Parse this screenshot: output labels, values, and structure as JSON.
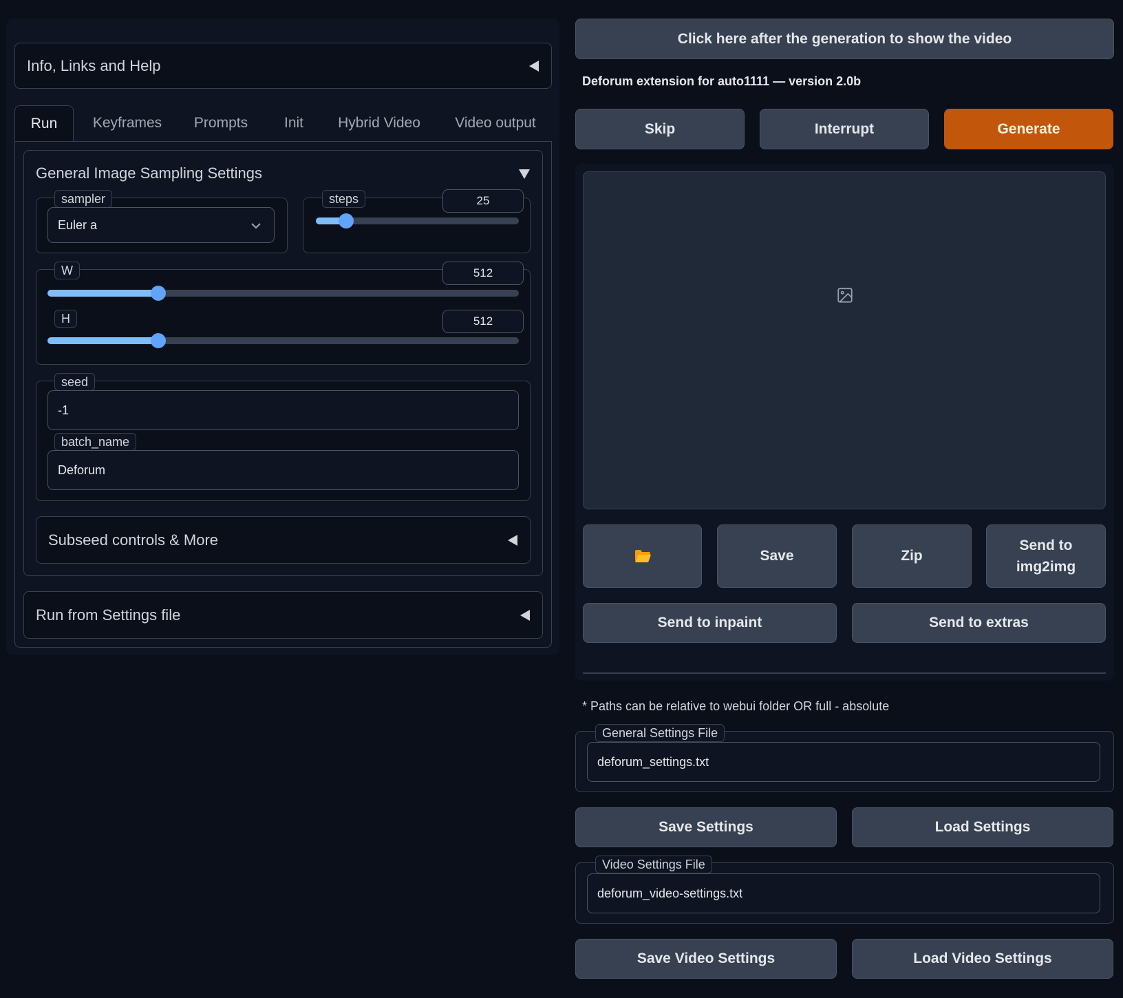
{
  "left": {
    "info_accordion": {
      "label": "Info, Links and Help"
    },
    "tabs": [
      "Run",
      "Keyframes",
      "Prompts",
      "Init",
      "Hybrid Video",
      "Video output"
    ],
    "general": {
      "title": "General Image Sampling Settings",
      "sampler": {
        "label": "sampler",
        "value": "Euler a"
      },
      "steps": {
        "label": "steps",
        "value": "25",
        "fraction": 0.15
      },
      "w": {
        "label": "W",
        "value": "512",
        "fraction": 0.235
      },
      "h": {
        "label": "H",
        "value": "512",
        "fraction": 0.235
      },
      "seed": {
        "label": "seed",
        "value": "-1"
      },
      "batch_name": {
        "label": "batch_name",
        "value": "Deforum"
      },
      "subseed": {
        "label": "Subseed controls & More"
      }
    },
    "run_from_settings": {
      "label": "Run from Settings file"
    }
  },
  "right": {
    "show_video_button": "Click here after the generation to show the video",
    "version_text": "Deforum extension for auto1111 — version 2.0b",
    "actions": {
      "skip": "Skip",
      "interrupt": "Interrupt",
      "generate": "Generate"
    },
    "gallery_buttons": {
      "folder_icon": "folder-icon",
      "save": "Save",
      "zip": "Zip",
      "send_img2img": "Send to img2img",
      "send_inpaint": "Send to inpaint",
      "send_extras": "Send to extras"
    },
    "paths_note": "* Paths can be relative to webui folder OR full - absolute",
    "general_settings_file": {
      "label": "General Settings File",
      "value": "deforum_settings.txt"
    },
    "save_settings": "Save Settings",
    "load_settings": "Load Settings",
    "video_settings_file": {
      "label": "Video Settings File",
      "value": "deforum_video-settings.txt"
    },
    "save_video_settings": "Save Video Settings",
    "load_video_settings": "Load Video Settings"
  },
  "colors": {
    "accent": "#c2570c",
    "slider": "#7fbdf8",
    "background": "#0b0f19"
  }
}
